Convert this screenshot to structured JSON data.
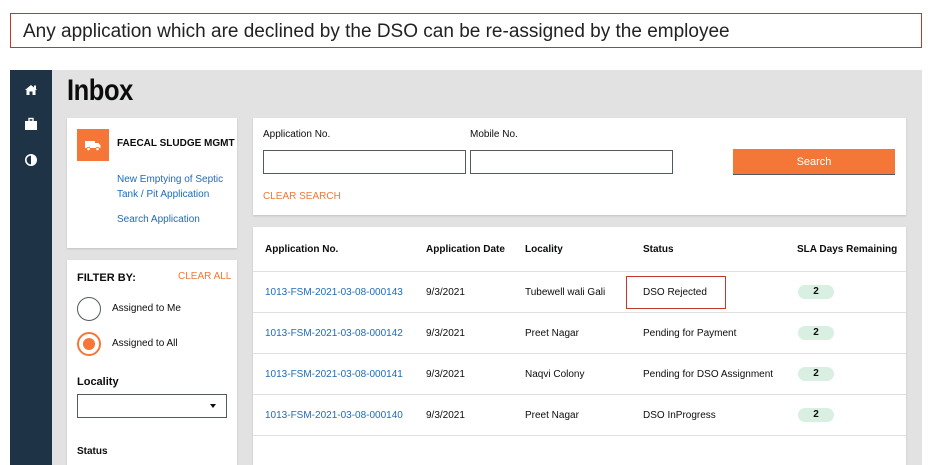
{
  "banner": {
    "text": "Any application which are declined by the DSO can be re-assigned by the employee"
  },
  "sidebar": {
    "icons": [
      "home-icon",
      "briefcase-icon",
      "contrast-icon"
    ]
  },
  "page": {
    "title": "Inbox"
  },
  "module": {
    "title": "FAECAL SLUDGE MGMT",
    "icon": "truck-icon",
    "link1": "New Emptying of Septic Tank / Pit Application",
    "link2": "Search Application"
  },
  "filter": {
    "label": "FILTER BY:",
    "clear_all": "CLEAR ALL",
    "options": [
      {
        "label": "Assigned to Me",
        "checked": false
      },
      {
        "label": "Assigned to All",
        "checked": true
      }
    ],
    "locality_label": "Locality",
    "locality_value": "",
    "status_label": "Status"
  },
  "search": {
    "application_label": "Application No.",
    "application_value": "",
    "mobile_label": "Mobile No.",
    "mobile_value": "",
    "button": "Search",
    "clear": "CLEAR SEARCH"
  },
  "table": {
    "headers": [
      "Application No.",
      "Application Date",
      "Locality",
      "Status",
      "SLA Days Remaining"
    ],
    "rows": [
      {
        "app_no": "1013-FSM-2021-03-08-000143",
        "date": "9/3/2021",
        "locality": "Tubewell wali Gali",
        "status": "DSO Rejected",
        "sla": "2"
      },
      {
        "app_no": "1013-FSM-2021-03-08-000142",
        "date": "9/3/2021",
        "locality": "Preet Nagar",
        "status": "Pending for Payment",
        "sla": "2"
      },
      {
        "app_no": "1013-FSM-2021-03-08-000141",
        "date": "9/3/2021",
        "locality": "Naqvi Colony",
        "status": "Pending for DSO Assignment",
        "sla": "2"
      },
      {
        "app_no": "1013-FSM-2021-03-08-000140",
        "date": "9/3/2021",
        "locality": "Preet Nagar",
        "status": "DSO InProgress",
        "sla": "2"
      }
    ]
  },
  "colors": {
    "accent": "#f47738",
    "sidebar": "#1f3347",
    "link": "#1e6bb8",
    "highlight": "#c0392b",
    "sla_badge": "#d9efe2"
  }
}
